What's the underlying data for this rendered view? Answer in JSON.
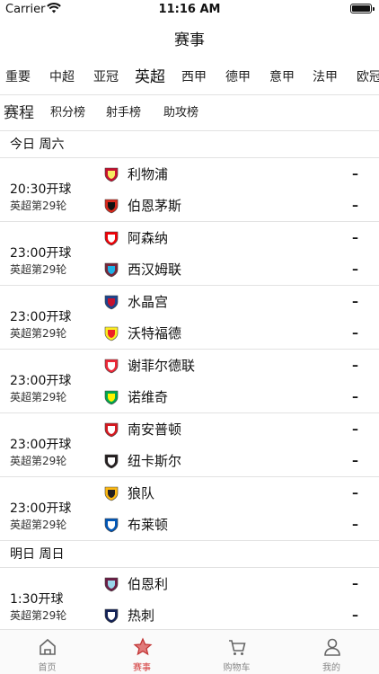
{
  "status_bar": {
    "carrier": "Carrier",
    "time": "11:16 AM"
  },
  "nav": {
    "title": "赛事"
  },
  "league_tabs": [
    "重要",
    "中超",
    "亚冠",
    "英超",
    "西甲",
    "德甲",
    "意甲",
    "法甲",
    "欧冠"
  ],
  "active_league": "英超",
  "sub_tabs": [
    "赛程",
    "积分榜",
    "射手榜",
    "助攻榜"
  ],
  "active_sub_tab": "赛程",
  "days": [
    {
      "label": "今日 周六",
      "matches": [
        {
          "kickoff": "20:30开球",
          "round": "英超第29轮",
          "home": "利物浦",
          "away": "伯恩茅斯",
          "home_score": "–",
          "away_score": "–"
        },
        {
          "kickoff": "23:00开球",
          "round": "英超第29轮",
          "home": "阿森纳",
          "away": "西汉姆联",
          "home_score": "–",
          "away_score": "–"
        },
        {
          "kickoff": "23:00开球",
          "round": "英超第29轮",
          "home": "水晶宫",
          "away": "沃特福德",
          "home_score": "–",
          "away_score": "–"
        },
        {
          "kickoff": "23:00开球",
          "round": "英超第29轮",
          "home": "谢菲尔德联",
          "away": "诺维奇",
          "home_score": "–",
          "away_score": "–"
        },
        {
          "kickoff": "23:00开球",
          "round": "英超第29轮",
          "home": "南安普顿",
          "away": "纽卡斯尔",
          "home_score": "–",
          "away_score": "–"
        },
        {
          "kickoff": "23:00开球",
          "round": "英超第29轮",
          "home": "狼队",
          "away": "布莱顿",
          "home_score": "–",
          "away_score": "–"
        }
      ]
    },
    {
      "label": "明日 周日",
      "matches": [
        {
          "kickoff": "1:30开球",
          "round": "英超第29轮",
          "home": "伯恩利",
          "away": "热刺",
          "home_score": "–",
          "away_score": "–"
        }
      ]
    }
  ],
  "tab_bar": [
    {
      "label": "首页",
      "icon": "home-icon"
    },
    {
      "label": "赛事",
      "icon": "star-icon"
    },
    {
      "label": "购物车",
      "icon": "cart-icon"
    },
    {
      "label": "我的",
      "icon": "profile-icon"
    }
  ],
  "active_tab": "赛事",
  "colors": {
    "accent": "#d33b3b",
    "divider": "#e2e2e2",
    "inactive": "#888888"
  }
}
